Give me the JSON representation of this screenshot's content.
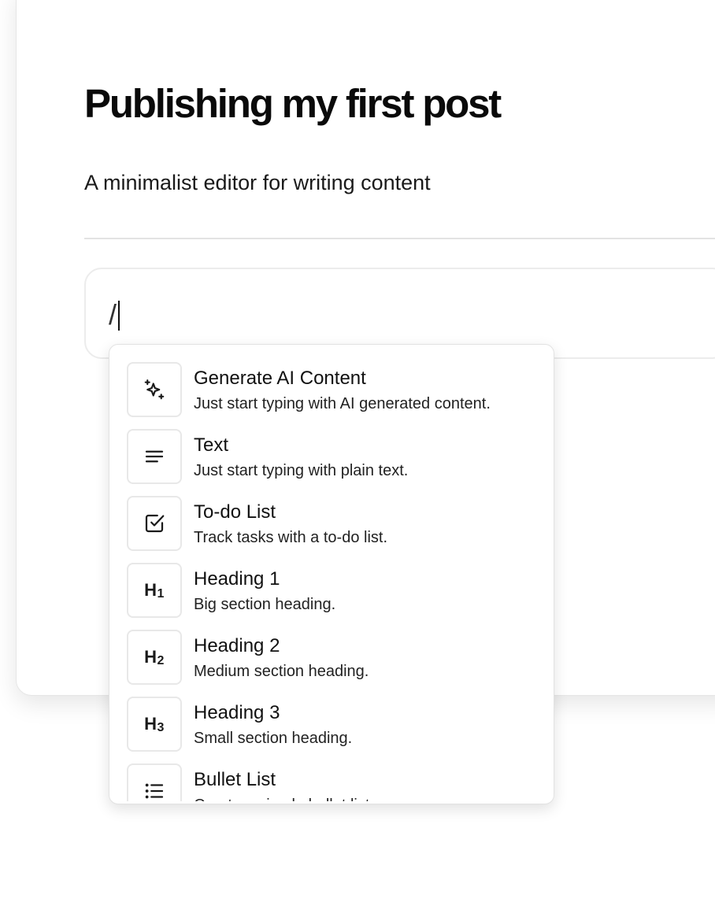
{
  "document": {
    "title": "Publishing my first post",
    "description": "A minimalist editor for writing content"
  },
  "editor": {
    "input_value": "/"
  },
  "command_menu": {
    "items": [
      {
        "icon": "sparkles-icon",
        "title": "Generate AI Content",
        "description": "Just start typing with AI generated content."
      },
      {
        "icon": "text-lines-icon",
        "title": "Text",
        "description": "Just start typing with plain text."
      },
      {
        "icon": "checkbox-icon",
        "title": "To-do List",
        "description": "Track tasks with a to-do list."
      },
      {
        "icon": "heading-1-icon",
        "title": "Heading 1",
        "description": "Big section heading.",
        "glyph": "H",
        "glyph_sub": "1"
      },
      {
        "icon": "heading-2-icon",
        "title": "Heading 2",
        "description": "Medium section heading.",
        "glyph": "H",
        "glyph_sub": "2"
      },
      {
        "icon": "heading-3-icon",
        "title": "Heading 3",
        "description": "Small section heading.",
        "glyph": "H",
        "glyph_sub": "3"
      },
      {
        "icon": "bullet-list-icon",
        "title": "Bullet List",
        "description": "Create a simple bullet list."
      }
    ]
  }
}
